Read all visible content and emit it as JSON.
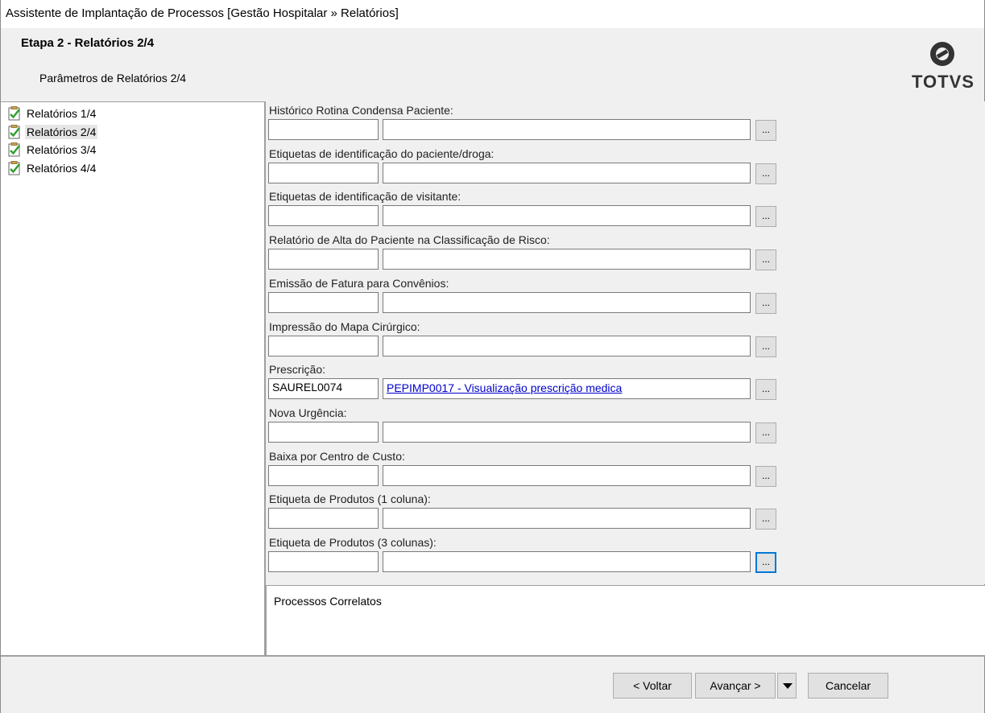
{
  "window": {
    "title": "Assistente de Implantação de Processos [Gestão Hospitalar » Relatórios]"
  },
  "header": {
    "step_title": "Etapa 2 - Relatórios 2/4",
    "step_subtitle": "Parâmetros de Relatórios 2/4",
    "logo_text": "TOTVS"
  },
  "tree": {
    "items": [
      {
        "label": "Relatórios 1/4",
        "checked": true,
        "selected": false
      },
      {
        "label": "Relatórios 2/4",
        "checked": true,
        "selected": true
      },
      {
        "label": "Relatórios 3/4",
        "checked": true,
        "selected": false
      },
      {
        "label": "Relatórios 4/4",
        "checked": true,
        "selected": false
      }
    ]
  },
  "form": {
    "lookup_label": "...",
    "fields": [
      {
        "label": "Histórico Rotina Condensa Paciente:",
        "code": "",
        "description": ""
      },
      {
        "label": "Etiquetas de identificação do paciente/droga:",
        "code": "",
        "description": ""
      },
      {
        "label": "Etiquetas de identificação de visitante:",
        "code": "",
        "description": ""
      },
      {
        "label": "Relatório de Alta do Paciente na Classificação de Risco:",
        "code": "",
        "description": ""
      },
      {
        "label": "Emissão de Fatura para Convênios:",
        "code": "",
        "description": ""
      },
      {
        "label": "Impressão do Mapa Cirúrgico:",
        "code": "",
        "description": ""
      },
      {
        "label": "Prescrição:",
        "code": "SAUREL0074",
        "description": "PEPIMP0017 - Visualização prescrição medica"
      },
      {
        "label": "Nova Urgência:",
        "code": "",
        "description": ""
      },
      {
        "label": "Baixa por Centro de Custo:",
        "code": "",
        "description": ""
      },
      {
        "label": "Etiqueta de Produtos (1 coluna):",
        "code": "",
        "description": ""
      },
      {
        "label": "Etiqueta de Produtos (3 colunas):",
        "code": "",
        "description": ""
      }
    ]
  },
  "correlatos": {
    "title": "Processos Correlatos"
  },
  "footer": {
    "back_label": "< Voltar",
    "next_label": "Avançar >",
    "cancel_label": "Cancelar"
  },
  "colors": {
    "link": "#0000cc",
    "focus": "#0078d7",
    "check_green": "#2e9e2e"
  }
}
